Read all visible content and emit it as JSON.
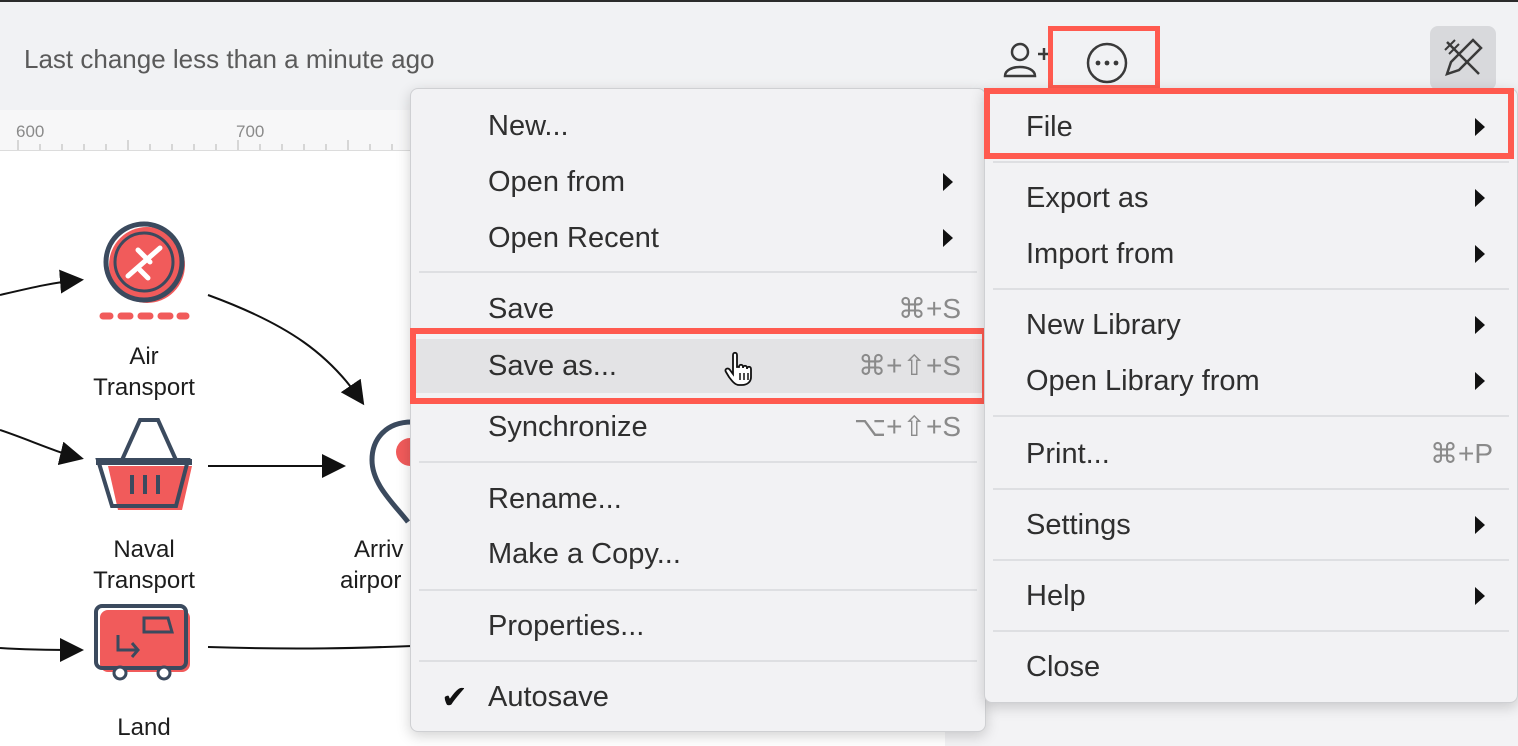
{
  "header": {
    "last_change": "Last change less than a minute ago"
  },
  "icons": {
    "share": "add-person-icon",
    "more": "ellipsis-circle-icon",
    "format": "format-pencil-icon"
  },
  "ruler": {
    "labels": [
      "600",
      "700"
    ]
  },
  "diagram": {
    "nodes": [
      {
        "label_1": "Air",
        "label_2": "Transport"
      },
      {
        "label_1": "Naval",
        "label_2": "Transport"
      },
      {
        "label_1": "Land",
        "label_2": ""
      },
      {
        "label_1": "Arriv",
        "label_2": "airpor"
      }
    ]
  },
  "main_menu": {
    "items": [
      {
        "label": "File",
        "submenu": true
      },
      {
        "label": "Export as",
        "submenu": true
      },
      {
        "label": "Import from",
        "submenu": true
      },
      {
        "label": "New Library",
        "submenu": true
      },
      {
        "label": "Open Library from",
        "submenu": true
      },
      {
        "label": "Print...",
        "shortcut": "⌘+P"
      },
      {
        "label": "Settings",
        "submenu": true
      },
      {
        "label": "Help",
        "submenu": true
      },
      {
        "label": "Close"
      }
    ]
  },
  "file_menu": {
    "items": [
      {
        "label": "New..."
      },
      {
        "label": "Open from",
        "submenu": true
      },
      {
        "label": "Open Recent",
        "submenu": true
      },
      {
        "label": "Save",
        "shortcut": "⌘+S"
      },
      {
        "label": "Save as...",
        "shortcut": "⌘+⇧+S"
      },
      {
        "label": "Synchronize",
        "shortcut": "⌥+⇧+S"
      },
      {
        "label": "Rename..."
      },
      {
        "label": "Make a Copy..."
      },
      {
        "label": "Properties..."
      },
      {
        "label": "Autosave",
        "checked": true
      }
    ]
  },
  "colors": {
    "highlight": "#ff5a4f",
    "icon_red": "#f15b5b",
    "icon_dark": "#3b4a5e"
  }
}
